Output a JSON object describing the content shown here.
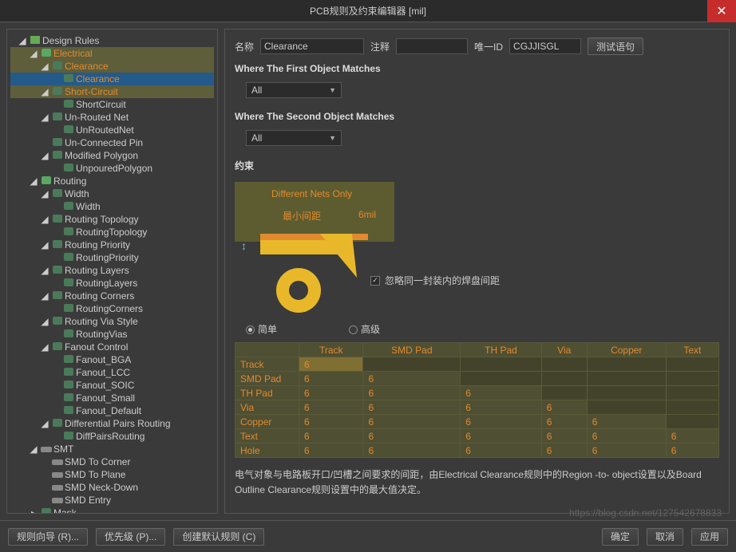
{
  "title": "PCB规则及约束编辑器 [mil]",
  "tree": {
    "root": "Design Rules",
    "electrical": "Electrical",
    "clearance_g": "Clearance",
    "clearance": "Clearance",
    "short_g": "Short-Circuit",
    "short": "ShortCircuit",
    "unrouted_g": "Un-Routed Net",
    "unrouted": "UnRoutedNet",
    "unconn": "Un-Connected Pin",
    "modpoly_g": "Modified Polygon",
    "modpoly": "UnpouredPolygon",
    "routing": "Routing",
    "width_g": "Width",
    "width": "Width",
    "topo_g": "Routing Topology",
    "topo": "RoutingTopology",
    "prio_g": "Routing Priority",
    "prio": "RoutingPriority",
    "layers_g": "Routing Layers",
    "layers": "RoutingLayers",
    "corners_g": "Routing Corners",
    "corners": "RoutingCorners",
    "via_g": "Routing Via Style",
    "via": "RoutingVias",
    "fanout_g": "Fanout Control",
    "fanout_bga": "Fanout_BGA",
    "fanout_lcc": "Fanout_LCC",
    "fanout_soic": "Fanout_SOIC",
    "fanout_small": "Fanout_Small",
    "fanout_default": "Fanout_Default",
    "diff_g": "Differential Pairs Routing",
    "diff": "DiffPairsRouting",
    "smt": "SMT",
    "smt_corner": "SMD To Corner",
    "smt_plane": "SMD To Plane",
    "smt_neck": "SMD Neck-Down",
    "smt_entry": "SMD Entry",
    "mask": "Mask"
  },
  "detail": {
    "name_label": "名称",
    "name_value": "Clearance",
    "comment_label": "注释",
    "comment_value": "",
    "id_label": "唯一ID",
    "id_value": "CGJJISGL",
    "test_btn": "测试语句",
    "where1": "Where The First Object Matches",
    "where2": "Where The Second Object Matches",
    "all": "All",
    "constraints": "约束",
    "diff_nets": "Different Nets Only",
    "min_clear": "最小间距",
    "min_value": "6mil",
    "ignore_pad": "忽略同一封装内的焊盘间距",
    "simple": "简单",
    "advanced": "高级",
    "matrix_headers": [
      "Track",
      "SMD Pad",
      "TH Pad",
      "Via",
      "Copper",
      "Text"
    ],
    "matrix_rows": [
      "Track",
      "SMD Pad",
      "TH Pad",
      "Via",
      "Copper",
      "Text",
      "Hole"
    ],
    "cell6": "6",
    "footnote": "电气对象与电路板开口/凹槽之间要求的间距，由Electrical Clearance规则中的Region -to- object设置以及Board Outline Clearance规则设置中的最大值决定。"
  },
  "footer": {
    "wizard": "规则向导 (R)...",
    "priority": "优先级 (P)...",
    "create": "创建默认规则 (C)",
    "ok": "确定",
    "cancel": "取消",
    "apply": "应用"
  },
  "watermark": "https://blog.csdn.net/127542678833"
}
